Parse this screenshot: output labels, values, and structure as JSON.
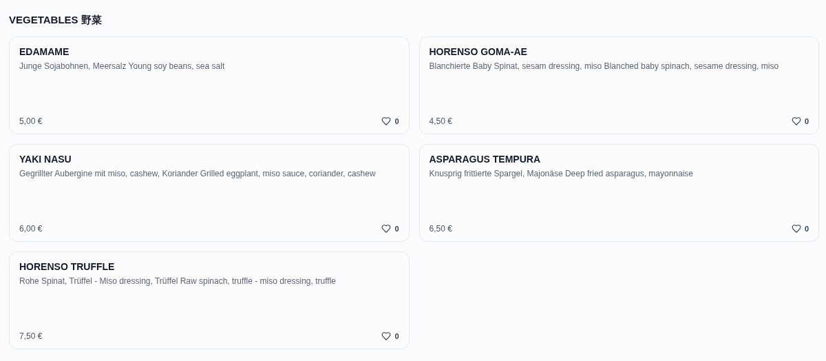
{
  "section": {
    "title": "VEGETABLES 野菜"
  },
  "items": [
    {
      "name": "EDAMAME",
      "description": "Junge Sojabohnen, Meersalz Young soy beans, sea salt",
      "price": "5,00 €",
      "likes": "0"
    },
    {
      "name": "HORENSO GOMA-AE",
      "description": "Blanchierte Baby Spinat, sesam dressing, miso Blanched baby spinach, sesame dressing, miso",
      "price": "4,50 €",
      "likes": "0"
    },
    {
      "name": "YAKI NASU",
      "description": "Gegrillter Aubergine mit miso, cashew, Koriander Grilled eggplant, miso sauce, coriander, cashew",
      "price": "6,00 €",
      "likes": "0"
    },
    {
      "name": "ASPARAGUS TEMPURA",
      "description": "Knusprig frittierte Spargel, Majonäse Deep fried asparagus, mayonnaise",
      "price": "6,50 €",
      "likes": "0"
    },
    {
      "name": "HORENSO TRUFFLE",
      "description": "Rohe Spinat, Trüffel - Miso dressing, Trüffel Raw spinach, truffle - miso dressing, truffle",
      "price": "7,50 €",
      "likes": "0"
    }
  ]
}
